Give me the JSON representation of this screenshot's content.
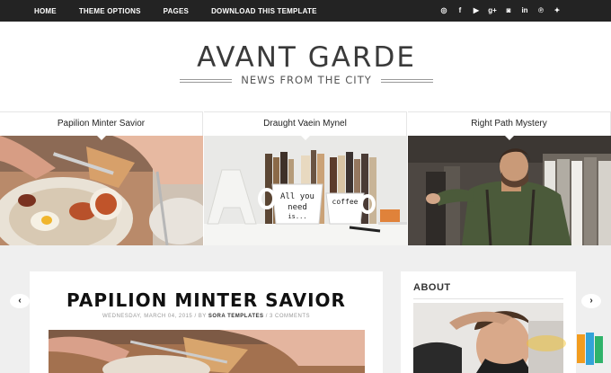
{
  "nav": {
    "items": [
      "HOME",
      "THEME OPTIONS",
      "PAGES",
      "DOWNLOAD THIS TEMPLATE"
    ]
  },
  "social": {
    "icons": [
      "dribbble-icon",
      "facebook-icon",
      "youtube-icon",
      "google-plus-icon",
      "instagram-icon",
      "linkedin-icon",
      "pinterest-icon",
      "twitter-icon"
    ],
    "glyphs": [
      "◎",
      "f",
      "▶",
      "g+",
      "◙",
      "in",
      "℗",
      "✦"
    ]
  },
  "header": {
    "title": "AVANT GARDE",
    "tagline": "NEWS FROM THE CITY"
  },
  "slider": {
    "slides": [
      {
        "title": "Papilion Minter Savior"
      },
      {
        "title": "Draught Vaein Mynel"
      },
      {
        "title": "Right Path Mystery"
      }
    ],
    "prev": "‹",
    "next": "›"
  },
  "post": {
    "title": "PAPILION MINTER SAVIOR",
    "date": "WEDNESDAY, MARCH 04, 2015",
    "by": "/ BY",
    "author": "SORA TEMPLATES",
    "comments": "/ 3 COMMENTS"
  },
  "sidebar": {
    "title": "ABOUT"
  },
  "colors": {
    "topbar": "#232323",
    "page_bg": "#efefef",
    "text_dark": "#222222"
  }
}
